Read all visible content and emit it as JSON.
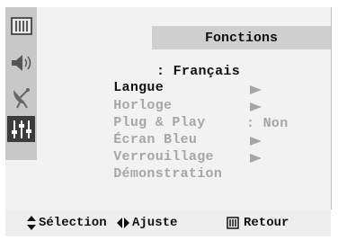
{
  "menu": {
    "title": "Fonctions",
    "items": [
      {
        "label": "Langue",
        "value": ": Français",
        "state": "selected"
      },
      {
        "label": "Horloge",
        "value": "",
        "state": "dim"
      },
      {
        "label": "Plug & Play",
        "value": "",
        "state": "dim"
      },
      {
        "label": "Écran Bleu",
        "value": ": Non",
        "state": "dim"
      },
      {
        "label": "Verrouillage",
        "value": "",
        "state": "dim"
      },
      {
        "label": "Démonstration",
        "value": "",
        "state": "dim"
      }
    ]
  },
  "sidebar": {
    "items": [
      {
        "icon": "picture-icon",
        "active": false
      },
      {
        "icon": "speaker-icon",
        "active": false
      },
      {
        "icon": "satellite-dish-icon",
        "active": false
      },
      {
        "icon": "sliders-icon",
        "active": true
      }
    ]
  },
  "footer": {
    "select_label": "Sélection",
    "adjust_label": "Ajuste",
    "return_label": "Retour"
  },
  "colors": {
    "dim_text": "#a6a6a6",
    "active_tab": "#3c3c3c",
    "sidebar": "#c8c8c8",
    "title_bar": "#cfcfcf"
  }
}
